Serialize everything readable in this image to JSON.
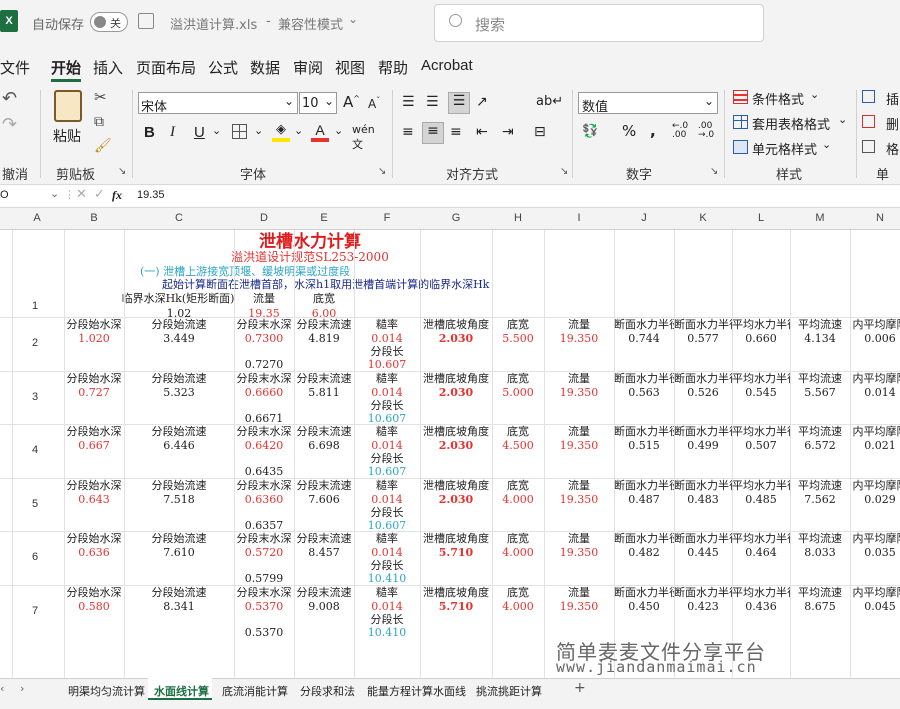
{
  "titlebar": {
    "app_icon": "X",
    "autosave_label": "自动保存",
    "autosave_state": "关",
    "filename": "溢洪道计算.xls",
    "mode": "兼容性模式",
    "search_placeholder": "搜索"
  },
  "menu": [
    "文件",
    "开始",
    "插入",
    "页面布局",
    "公式",
    "数据",
    "审阅",
    "视图",
    "帮助",
    "Acrobat"
  ],
  "ribbon": {
    "undo_group": "撤消",
    "clipboard_group": "剪贴板",
    "paste_label": "粘贴",
    "font_group": "字体",
    "font_name": "宋体",
    "font_size": "10",
    "bold": "B",
    "italic": "I",
    "underline": "U",
    "align_group": "对齐方式",
    "number_group": "数字",
    "number_format": "数值",
    "styles_group": "样式",
    "cond_format": "条件格式",
    "table_format": "套用表格格式",
    "cell_styles": "单元格样式",
    "cells_group": "单元",
    "insert": "插",
    "delete": "删",
    "format": "格"
  },
  "formula_bar": {
    "name_box": "O",
    "fx": "fx",
    "value": "19.35"
  },
  "columns": [
    "A",
    "B",
    "C",
    "D",
    "E",
    "F",
    "G",
    "H",
    "I",
    "J",
    "K",
    "L",
    "M",
    "N"
  ],
  "sheet": {
    "title": "泄槽水力计算",
    "subtitle": "溢洪道设计规范SL253-2000",
    "note1": "(一) 泄槽上游接宽顶堰、缓坡明渠或过度段",
    "note2": "起始计算断面在泄槽首部，水深h1取用泄槽首端计算的临界水深Hk",
    "hdr_hk": "临界水深Hk(矩形断面)",
    "hdr_flow": "流量",
    "hdr_width": "底宽",
    "hk": "1.02",
    "flow": "19.35",
    "width": "6.00",
    "labels": {
      "start_depth": "分段始水深",
      "start_vel": "分段始流速",
      "end_depth": "分段末水深",
      "end_vel": "分段末流速",
      "rough": "糙率",
      "angle": "泄槽底坡角度",
      "bottom": "底宽",
      "flow": "流量",
      "r1": "断面水力半径",
      "r2": "断面水力半径",
      "ravg": "平均水力半径",
      "vavg": "平均流速",
      "friction": "内平均摩阻",
      "seglen": "分段长"
    },
    "blocks": [
      {
        "row": "2",
        "h1": "1.020",
        "v1": "3.449",
        "h2": "0.7300",
        "v2": "4.819",
        "n": "0.014",
        "ang": "2.030",
        "b": "5.500",
        "q": "19.350",
        "r1": "0.744",
        "r2": "0.577",
        "ra": "0.660",
        "va": "4.134",
        "j": "0.006",
        "next": "0.7270",
        "len": "10.607"
      },
      {
        "row": "3",
        "h1": "0.727",
        "v1": "5.323",
        "h2": "0.6660",
        "v2": "5.811",
        "n": "0.014",
        "ang": "2.030",
        "b": "5.000",
        "q": "19.350",
        "r1": "0.563",
        "r2": "0.526",
        "ra": "0.545",
        "va": "5.567",
        "j": "0.014",
        "next": "0.6671",
        "len": "10.607"
      },
      {
        "row": "4",
        "h1": "0.667",
        "v1": "6.446",
        "h2": "0.6420",
        "v2": "6.698",
        "n": "0.014",
        "ang": "2.030",
        "b": "4.500",
        "q": "19.350",
        "r1": "0.515",
        "r2": "0.499",
        "ra": "0.507",
        "va": "6.572",
        "j": "0.021",
        "next": "0.6435",
        "len": "10.607"
      },
      {
        "row": "5",
        "h1": "0.643",
        "v1": "7.518",
        "h2": "0.6360",
        "v2": "7.606",
        "n": "0.014",
        "ang": "2.030",
        "b": "4.000",
        "q": "19.350",
        "r1": "0.487",
        "r2": "0.483",
        "ra": "0.485",
        "va": "7.562",
        "j": "0.029",
        "next": "0.6357",
        "len": "10.607"
      },
      {
        "row": "6",
        "h1": "0.636",
        "v1": "7.610",
        "h2": "0.5720",
        "v2": "8.457",
        "n": "0.014",
        "ang": "5.710",
        "b": "4.000",
        "q": "19.350",
        "r1": "0.482",
        "r2": "0.445",
        "ra": "0.464",
        "va": "8.033",
        "j": "0.035",
        "next": "0.5799",
        "len": "10.410"
      },
      {
        "row": "7",
        "h1": "0.580",
        "v1": "8.341",
        "h2": "0.5370",
        "v2": "9.008",
        "n": "0.014",
        "ang": "5.710",
        "b": "4.000",
        "q": "19.350",
        "r1": "0.450",
        "r2": "0.423",
        "ra": "0.436",
        "va": "8.675",
        "j": "0.045",
        "next": "0.5370",
        "len": "10.410"
      }
    ]
  },
  "tabs": [
    "明渠均匀流计算",
    "水面线计算",
    "底流消能计算",
    "分段求和法",
    "能量方程计算水面线",
    "挑流挑距计算"
  ],
  "active_tab": 1,
  "watermark": {
    "line1": "简单麦麦文件分享平台",
    "line2": "www.jiandanmaimai.cn"
  },
  "colors": {
    "excel_green": "#1d6f42",
    "red": "#e8322e",
    "cyan": "#2ba6c6",
    "title_red": "#e01b1b"
  }
}
